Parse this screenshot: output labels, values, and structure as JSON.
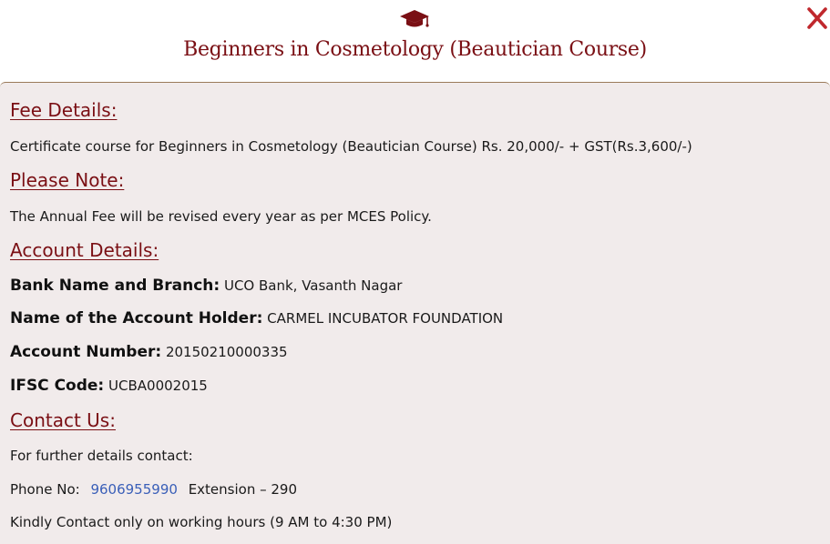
{
  "header": {
    "icon": "graduation-cap-icon",
    "title": "Beginners in Cosmetology (Beautician Course)",
    "close_icon": "close-icon",
    "close_symbol": "✕"
  },
  "colors": {
    "accent": "#7a0f14",
    "close": "#c0282d",
    "body_bg": "#f1ebeb",
    "link": "#3a5fb8"
  },
  "fee": {
    "heading": "Fee Details:",
    "text": "Certificate course for Beginners in Cosmetology (Beautician Course) Rs. 20,000/- + GST(Rs.3,600/-)"
  },
  "note": {
    "heading": "Please Note:",
    "text": "The Annual Fee will be revised every year as per MCES Policy."
  },
  "account": {
    "heading": "Account Details:",
    "bank_label": "Bank Name and Branch:",
    "bank_value": "UCO Bank, Vasanth Nagar",
    "holder_label": "Name of the Account Holder:",
    "holder_value": "CARMEL INCUBATOR FOUNDATION",
    "number_label": "Account Number:",
    "number_value": "20150210000335",
    "ifsc_label": "IFSC Code:",
    "ifsc_value": "UCBA0002015"
  },
  "contact": {
    "heading": "Contact Us:",
    "intro": "For further details contact:",
    "phone_label": "Phone No:",
    "phone_number": "9606955990",
    "extension": "Extension – 290",
    "hours": "Kindly Contact only on working hours (9 AM to 4:30 PM)"
  }
}
